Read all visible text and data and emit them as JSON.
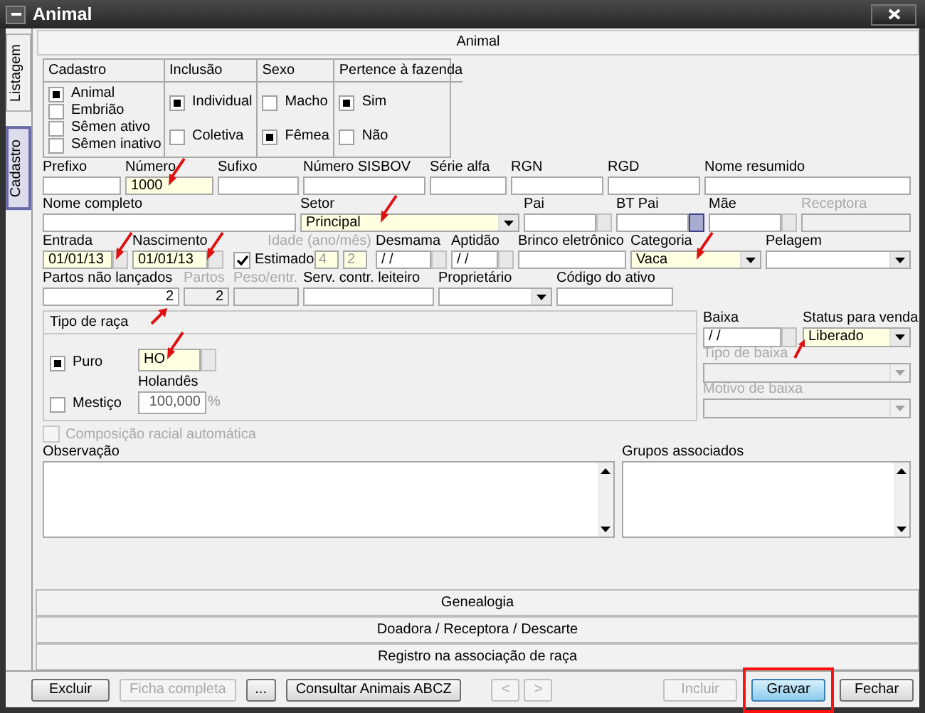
{
  "window": {
    "title": "Animal"
  },
  "side_tabs": [
    {
      "label": "Listagem",
      "selected": false
    },
    {
      "label": "Cadastro",
      "selected": true
    }
  ],
  "panel_title": "Animal",
  "option_groups": [
    {
      "title": "Cadastro",
      "options": [
        {
          "label": "Animal",
          "selected": true
        },
        {
          "label": "Embrião",
          "selected": false
        },
        {
          "label": "Sêmen ativo",
          "selected": false
        },
        {
          "label": "Sêmen inativo",
          "selected": false
        }
      ]
    },
    {
      "title": "Inclusão",
      "options": [
        {
          "label": "Individual",
          "selected": true
        },
        {
          "label": "Coletiva",
          "selected": false
        }
      ]
    },
    {
      "title": "Sexo",
      "options": [
        {
          "label": "Macho",
          "selected": false
        },
        {
          "label": "Fêmea",
          "selected": true
        }
      ]
    },
    {
      "title": "Pertence à fazenda",
      "options": [
        {
          "label": "Sim",
          "selected": true
        },
        {
          "label": "Não",
          "selected": false
        }
      ]
    }
  ],
  "rows": [
    [
      {
        "kind": "text",
        "label": "Prefixo"
      },
      {
        "kind": "text",
        "label": "Número",
        "value": "1000",
        "highlighted": true,
        "arrow": true
      },
      {
        "kind": "text",
        "label": "Sufixo"
      },
      {
        "kind": "text",
        "label": "Número SISBOV"
      },
      {
        "kind": "text",
        "label": "Série alfa"
      },
      {
        "kind": "text",
        "label": "RGN"
      },
      {
        "kind": "text",
        "label": "RGD"
      },
      {
        "kind": "text",
        "label": "Nome resumido"
      }
    ],
    [
      {
        "kind": "text",
        "label": "Nome completo"
      },
      {
        "kind": "combo",
        "label": "Setor",
        "value": "Principal",
        "highlighted": true,
        "arrow": true
      },
      {
        "kind": "lookup",
        "label": "Pai"
      },
      {
        "kind": "lookup",
        "label": "BT Pai",
        "button_focused": true
      },
      {
        "kind": "lookup",
        "label": "Mãe"
      },
      {
        "kind": "text",
        "label": "Receptora",
        "disabled": true
      }
    ],
    [
      {
        "kind": "lookup",
        "label": "Entrada",
        "value": "01/01/13",
        "highlighted": true,
        "arrow": true
      },
      {
        "kind": "lookup",
        "label": "Nascimento",
        "value": "01/01/13",
        "highlighted": true,
        "arrow": true
      },
      {
        "kind": "check",
        "label": "Estimado",
        "checked": true
      },
      {
        "kind": "pair",
        "label": "Idade (ano/mês)",
        "disabled": true,
        "values": [
          "4",
          "2"
        ]
      },
      {
        "kind": "lookup",
        "label": "Desmama",
        "value": " / /"
      },
      {
        "kind": "lookup",
        "label": "Aptidão",
        "value": " / /"
      },
      {
        "kind": "text",
        "label": "Brinco eletrônico"
      },
      {
        "kind": "combo",
        "label": "Categoria",
        "value": "Vaca",
        "highlighted": true,
        "arrow": true
      },
      {
        "kind": "combo",
        "label": "Pelagem"
      }
    ],
    [
      {
        "kind": "number",
        "label": "Partos não lançados",
        "value": "2",
        "arrow": true
      },
      {
        "kind": "number",
        "label": "Partos",
        "value": "2",
        "disabled": true
      },
      {
        "kind": "text",
        "label": "Peso/entr.",
        "disabled": true
      },
      {
        "kind": "text",
        "label": "Serv. contr. leiteiro"
      },
      {
        "kind": "combo",
        "label": "Proprietário"
      },
      {
        "kind": "text",
        "label": "Código do ativo"
      }
    ]
  ],
  "race_group": {
    "title": "Tipo de raça",
    "options": [
      {
        "label": "Puro",
        "selected": true
      },
      {
        "label": "Mestiço",
        "selected": false
      }
    ],
    "code": {
      "value": "HO",
      "highlighted": true,
      "arrow": true
    },
    "breed": "Holandês",
    "percent": {
      "value": "100,000",
      "unit": "%"
    }
  },
  "exit_fields": [
    {
      "kind": "lookup",
      "label": "Baixa",
      "value": " / /"
    },
    {
      "kind": "combo",
      "label": "Status para venda",
      "value": "Liberado",
      "highlighted": true,
      "arrow": true
    },
    {
      "kind": "combo",
      "label": "Tipo de baixa",
      "disabled": true
    },
    {
      "kind": "combo",
      "label": "Motivo de baixa",
      "disabled": true
    }
  ],
  "auto_composition": {
    "label": "Composição racial automática",
    "checked": false,
    "disabled": true
  },
  "memos": [
    {
      "label": "Observação"
    },
    {
      "label": "Grupos associados"
    }
  ],
  "sections": [
    "Genealogia",
    "Doadora / Receptora / Descarte",
    "Registro na associação de raça"
  ],
  "buttons_left": [
    {
      "label": "Excluir",
      "disabled": false
    },
    {
      "label": "Ficha completa",
      "disabled": true
    },
    {
      "label": "...",
      "disabled": false
    },
    {
      "label": "Consultar Animais ABCZ",
      "disabled": false
    }
  ],
  "nav_buttons": [
    {
      "label": "<",
      "disabled": true
    },
    {
      "label": ">",
      "disabled": true
    }
  ],
  "buttons_right": [
    {
      "label": "Incluir",
      "disabled": true,
      "default": false,
      "highlighted": false
    },
    {
      "label": "Gravar",
      "disabled": false,
      "default": true,
      "highlighted": true
    },
    {
      "label": "Fechar",
      "disabled": false,
      "default": false,
      "highlighted": false
    }
  ]
}
